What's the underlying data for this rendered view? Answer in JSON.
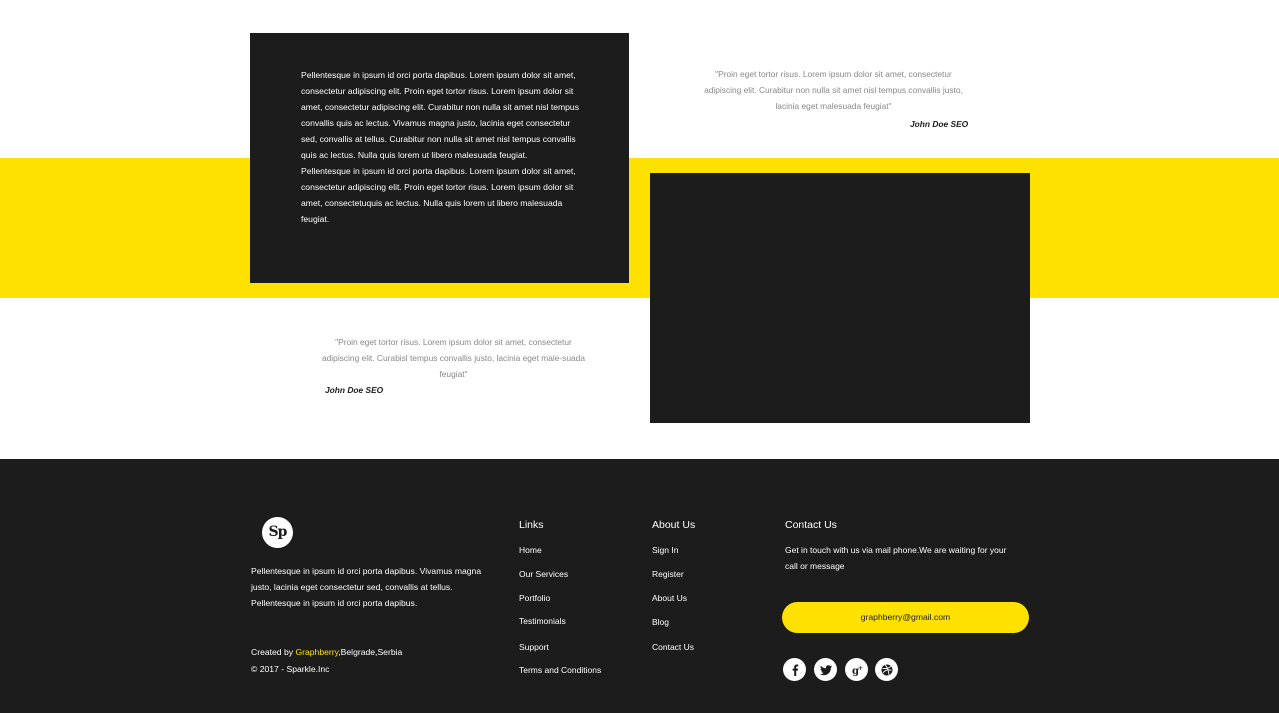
{
  "content": {
    "paragraph_1": "Pellentesque in ipsum id orci porta dapibus. Lorem ipsum dolor sit amet, consectetur adipiscing elit. Proin eget tortor risus. Lorem ipsum dolor sit amet, consectetur adipiscing elit. Curabitur non nulla sit amet nisl tempus convallis quis ac lectus. Vivamus magna justo, lacinia eget consectetur sed, convallis at tellus. Curabitur non nulla sit amet nisl tempus convallis quis ac lectus. Nulla quis lorem ut libero malesuada feugiat.",
    "paragraph_2": "Pellentesque in ipsum id orci porta dapibus. Lorem ipsum dolor sit amet, consectetur adipiscing elit. Proin eget tortor risus. Lorem ipsum dolor sit amet, consectetuquis ac lectus. Nulla quis lorem ut libero malesuada feugiat."
  },
  "testimonials": [
    {
      "quote": "\"Proin eget tortor risus. Lorem ipsum dolor sit amet, consectetur adipiscing elit. Curabitur non nulla sit amet nisl tempus convallis justo, lacinia eget malesuada feugiat\"",
      "author": "John Doe SEO"
    },
    {
      "quote": "\"Proin eget tortor risus. Lorem ipsum dolor sit amet, consectetur adipiscing elit. Curabisl tempus convallis justo, lacinia eget male-suada feugiat\"",
      "author": "John Doe SEO"
    }
  ],
  "footer": {
    "logo_text": "Sp",
    "about": "Pellentesque in ipsum id orci porta dapibus. Vivamus magna justo, lacinia eget consectetur sed, convallis at tellus. Pellentesque in ipsum id orci porta dapibus.",
    "credit_prefix": "Created by ",
    "credit_brand": "Graphberry",
    "credit_suffix": ",Belgrade,Serbia",
    "copyright": "© 2017 - Sparkle.Inc",
    "links_title": "Links",
    "links": [
      "Home",
      "Our Services",
      "Portfolio",
      "Testimonials",
      "Support",
      "Terms and Conditions"
    ],
    "about_title": "About Us",
    "about_links": [
      "Sign In",
      "Register",
      "About Us",
      "Blog",
      "Contact Us"
    ],
    "contact_title": "Contact Us",
    "contact_text": "Get in touch with us via mail phone.We are waiting for your call or message",
    "email": "graphberry@gmail.com",
    "social_icons": [
      "facebook-icon",
      "twitter-icon",
      "google-plus-icon",
      "dribbble-icon"
    ]
  },
  "colors": {
    "accent": "#ffe100",
    "dark": "#1c1c1c",
    "light": "#ffffff",
    "muted": "#888888"
  }
}
